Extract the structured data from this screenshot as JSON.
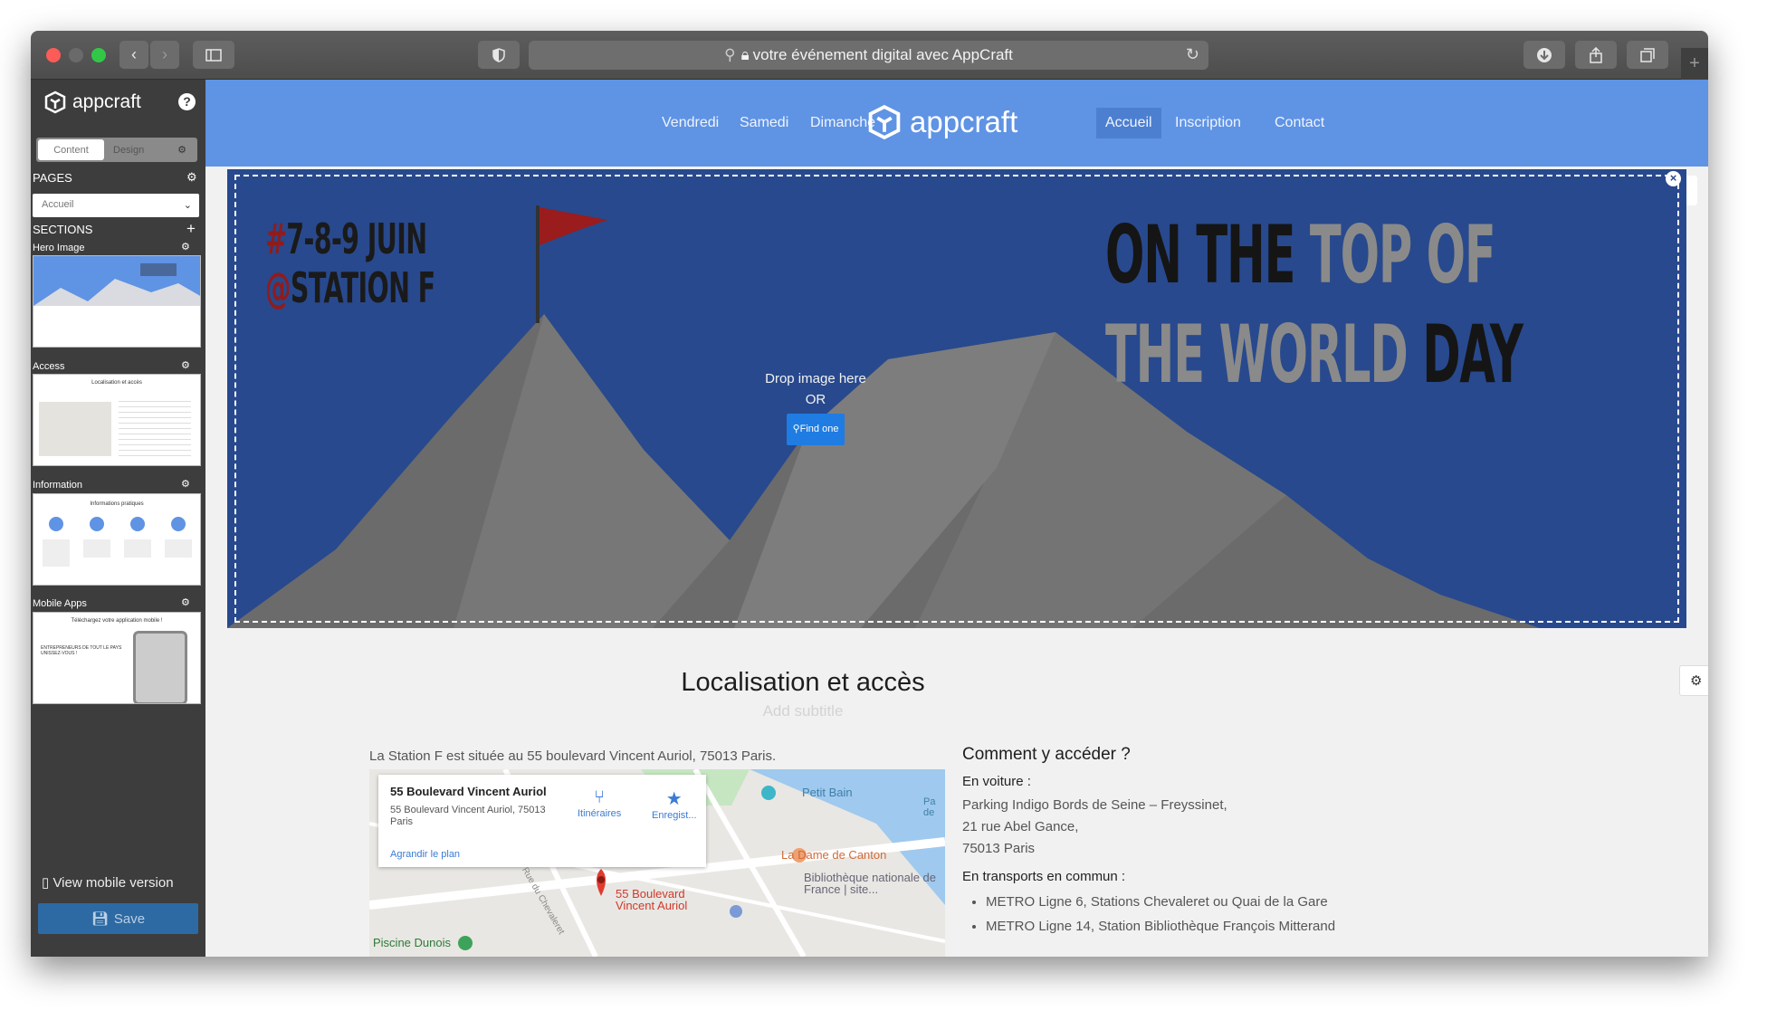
{
  "browser": {
    "address": "votre événement digital avec AppCraft"
  },
  "sidebar": {
    "logo": "appcraft",
    "help": "?",
    "tab_content": "Content",
    "tab_design": "Design",
    "pages_label": "PAGES",
    "page_select": "Accueil",
    "sections_label": "SECTIONS",
    "sections": [
      {
        "label": "Hero Image"
      },
      {
        "label": "Access"
      },
      {
        "label": "Information"
      },
      {
        "label": "Mobile Apps"
      }
    ],
    "thumb_access_title": "Localisation et accès",
    "thumb_info_title": "Informations pratiques",
    "thumb_mobile_title": "Téléchargez votre application mobile !",
    "thumb_mobile_text": "ENTREPRENEURS DE TOUT LE PAYS UNISSEZ-VOUS !",
    "view_mobile": "View mobile version",
    "save": "Save"
  },
  "nav": {
    "left": [
      "Vendredi",
      "Samedi",
      "Dimanche"
    ],
    "logo": "appcraft",
    "right": [
      "Accueil",
      "Inscription",
      "Contact"
    ]
  },
  "hero": {
    "date_line1_hash": "#",
    "date_line1": "7-8-9 JUIN",
    "date_line2_at": "@",
    "date_line2": "STATION F",
    "tag_1a": "ON THE ",
    "tag_1b": "TOP OF",
    "tag_2a": "THE WORLD ",
    "tag_2b": "DAY",
    "drop_text": "Drop image here",
    "or_text": "OR",
    "find_btn": "Find one"
  },
  "access": {
    "title": "Localisation et accès",
    "subtitle_placeholder": "Add subtitle",
    "intro": "La Station F est située au 55 boulevard Vincent Auriol, 75013 Paris.",
    "map": {
      "card_title": "55 Boulevard Vincent Auriol",
      "card_addr": "55 Boulevard Vincent Auriol, 75013 Paris",
      "card_link": "Agrandir le plan",
      "btn_itin": "Itinéraires",
      "btn_save": "Enregist...",
      "poi_petit_bain": "Petit Bain",
      "poi_dame": "La Dame de Canton",
      "poi_bnf": "Bibliothèque nationale de France | site...",
      "poi_pin": "55 Boulevard Vincent Auriol",
      "poi_piscine": "Piscine Dunois",
      "street_chevaleret": "Rue du Chevaleret",
      "poi_pa": "Pa de"
    },
    "how_title": "Comment y accéder ?",
    "car_label": "En voiture :",
    "car_lines": [
      "Parking Indigo Bords de Seine – Freyssinet,",
      "21 rue Abel Gance,",
      "75013 Paris"
    ],
    "transit_label": "En transports en commun :",
    "transit_items": [
      "METRO Ligne 6, Stations Chevaleret ou Quai de la Gare",
      "METRO Ligne 14, Station Bibliothèque François Mitterand"
    ]
  },
  "colors": {
    "nav_bg": "#5f93e4",
    "hero_bg": "#28498d",
    "sidebar_bg": "#3d3d3d",
    "save_btn": "#2d6aa3",
    "hash_red": "#8f1c1c"
  }
}
